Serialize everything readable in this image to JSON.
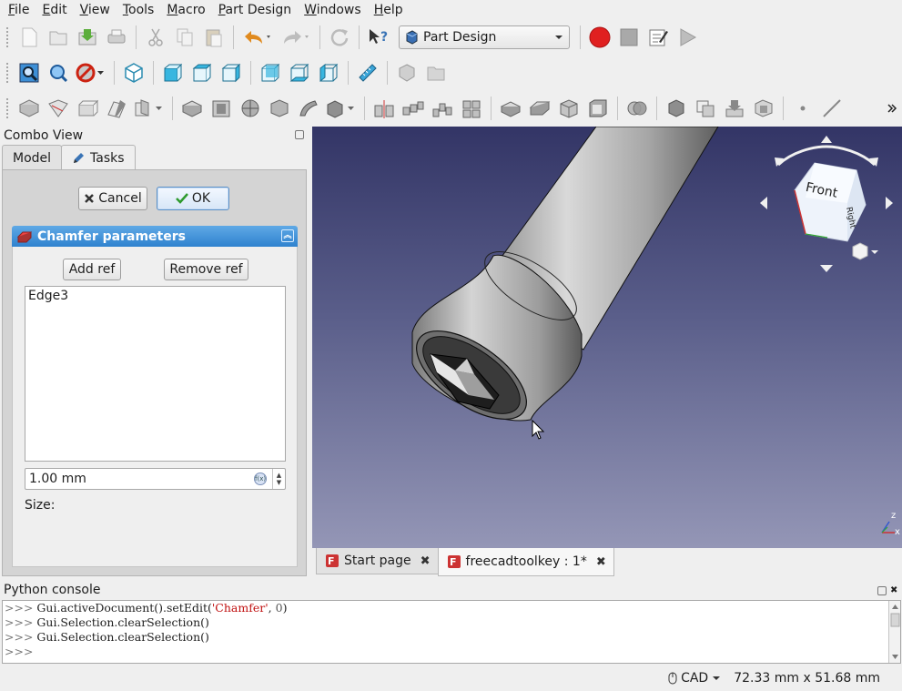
{
  "menu": [
    "File",
    "Edit",
    "View",
    "Tools",
    "Macro",
    "Part Design",
    "Windows",
    "Help"
  ],
  "workbench": {
    "selected": "Part Design"
  },
  "combo_view": {
    "title": "Combo View",
    "tabs": [
      {
        "label": "Model"
      },
      {
        "label": "Tasks"
      }
    ],
    "cancel_label": "Cancel",
    "ok_label": "OK",
    "panel_title": "Chamfer parameters",
    "add_ref_label": "Add ref",
    "remove_ref_label": "Remove ref",
    "refs": [
      "Edge3"
    ],
    "size_value": "1.00 mm",
    "size_label": "Size:"
  },
  "navcube": {
    "front_label": "Front",
    "right_label": "Right"
  },
  "axis": {
    "z": "z",
    "x": "x"
  },
  "doc_tabs": [
    {
      "label": "Start page",
      "active": false
    },
    {
      "label": "freecadtoolkey : 1*",
      "active": true
    }
  ],
  "python_console": {
    "title": "Python console",
    "prompt": ">>>",
    "lines": [
      {
        "pre": "Gui.activeDocument().setEdit(",
        "str": "'Chamfer'",
        "mid": ", ",
        "num": "0",
        "post": ")"
      },
      {
        "pre": "Gui.Selection.clearSelection()"
      },
      {
        "pre": "Gui.Selection.clearSelection()"
      }
    ]
  },
  "status": {
    "nav_style": "CAD",
    "dimensions": "72.33 mm x 51.68 mm"
  },
  "colors": {
    "accent_blue": "#2f82cf",
    "record_red": "#e02020",
    "viewport_top": "#333566",
    "viewport_bottom": "#9496b6"
  }
}
